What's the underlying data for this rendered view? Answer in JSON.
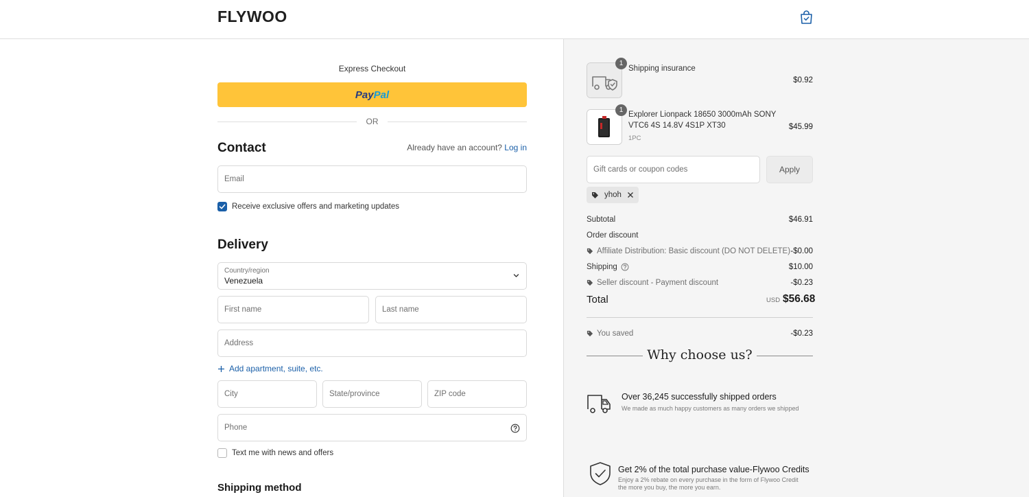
{
  "header": {
    "logo": "FLYWOO",
    "cart_icon": "shopping-bag-icon"
  },
  "express": {
    "label": "Express Checkout",
    "paypal_pay": "Pay",
    "paypal_pal": "Pal",
    "or_text": "OR"
  },
  "contact": {
    "title": "Contact",
    "account_prompt": "Already have an account?",
    "login_link": "Log in",
    "email_placeholder": "Email",
    "marketing_label": "Receive exclusive offers and marketing updates",
    "marketing_checked": true
  },
  "delivery": {
    "title": "Delivery",
    "country_label": "Country/region",
    "country_value": "Venezuela",
    "first_name_placeholder": "First name",
    "last_name_placeholder": "Last name",
    "address_placeholder": "Address",
    "add_apartment": "Add apartment, suite, etc.",
    "city_placeholder": "City",
    "state_placeholder": "State/province",
    "zip_placeholder": "ZIP code",
    "phone_placeholder": "Phone",
    "sms_label": "Text me with news and offers",
    "sms_checked": false
  },
  "shipping_method": {
    "title": "Shipping method"
  },
  "order": {
    "items": [
      {
        "name": "Shipping insurance",
        "variant": "",
        "price": "$0.92",
        "quantity": "1",
        "icon": "truck-shield-icon"
      },
      {
        "name_line1": "Explorer Lionpack 18650 3000mAh SONY",
        "name_line2": "VTC6 4S 14.8V 4S1P XT30",
        "variant": "1PC",
        "price": "$45.99",
        "quantity": "1",
        "icon": "battery-pack-image"
      }
    ],
    "coupon_placeholder": "Gift cards or coupon codes",
    "apply_label": "Apply",
    "applied_code": "yhoh",
    "subtotal_label": "Subtotal",
    "subtotal_value": "$46.91",
    "order_discount_label": "Order discount",
    "affiliate_discount_label": "Affiliate Distribution: Basic discount (DO NOT DELETE)",
    "affiliate_discount_value": "-$0.00",
    "shipping_label": "Shipping",
    "shipping_value": "$10.00",
    "seller_discount_label": "Seller discount - Payment discount",
    "seller_discount_value": "-$0.23",
    "total_label": "Total",
    "total_currency": "USD",
    "total_value": "$56.68",
    "saved_label": "You saved",
    "saved_value": "-$0.23"
  },
  "why": {
    "title": "Why choose us?",
    "features": [
      {
        "icon": "delivery-truck-icon",
        "title": "Over 36,245 successfully shipped orders",
        "desc": "We made as much happy customers as many orders we shipped"
      },
      {
        "icon": "shield-check-icon",
        "title": "Get 2% of the total purchase value-Flywoo Credits",
        "desc_line1": "Enjoy a 2% rebate on every purchase in the form of Flywoo Credit",
        "desc_line2": "the more you buy, the more you earn."
      }
    ]
  },
  "colors": {
    "paypal_yellow": "#ffc439",
    "link_blue": "#1a5fa8",
    "summary_bg": "#f5f5f5"
  }
}
